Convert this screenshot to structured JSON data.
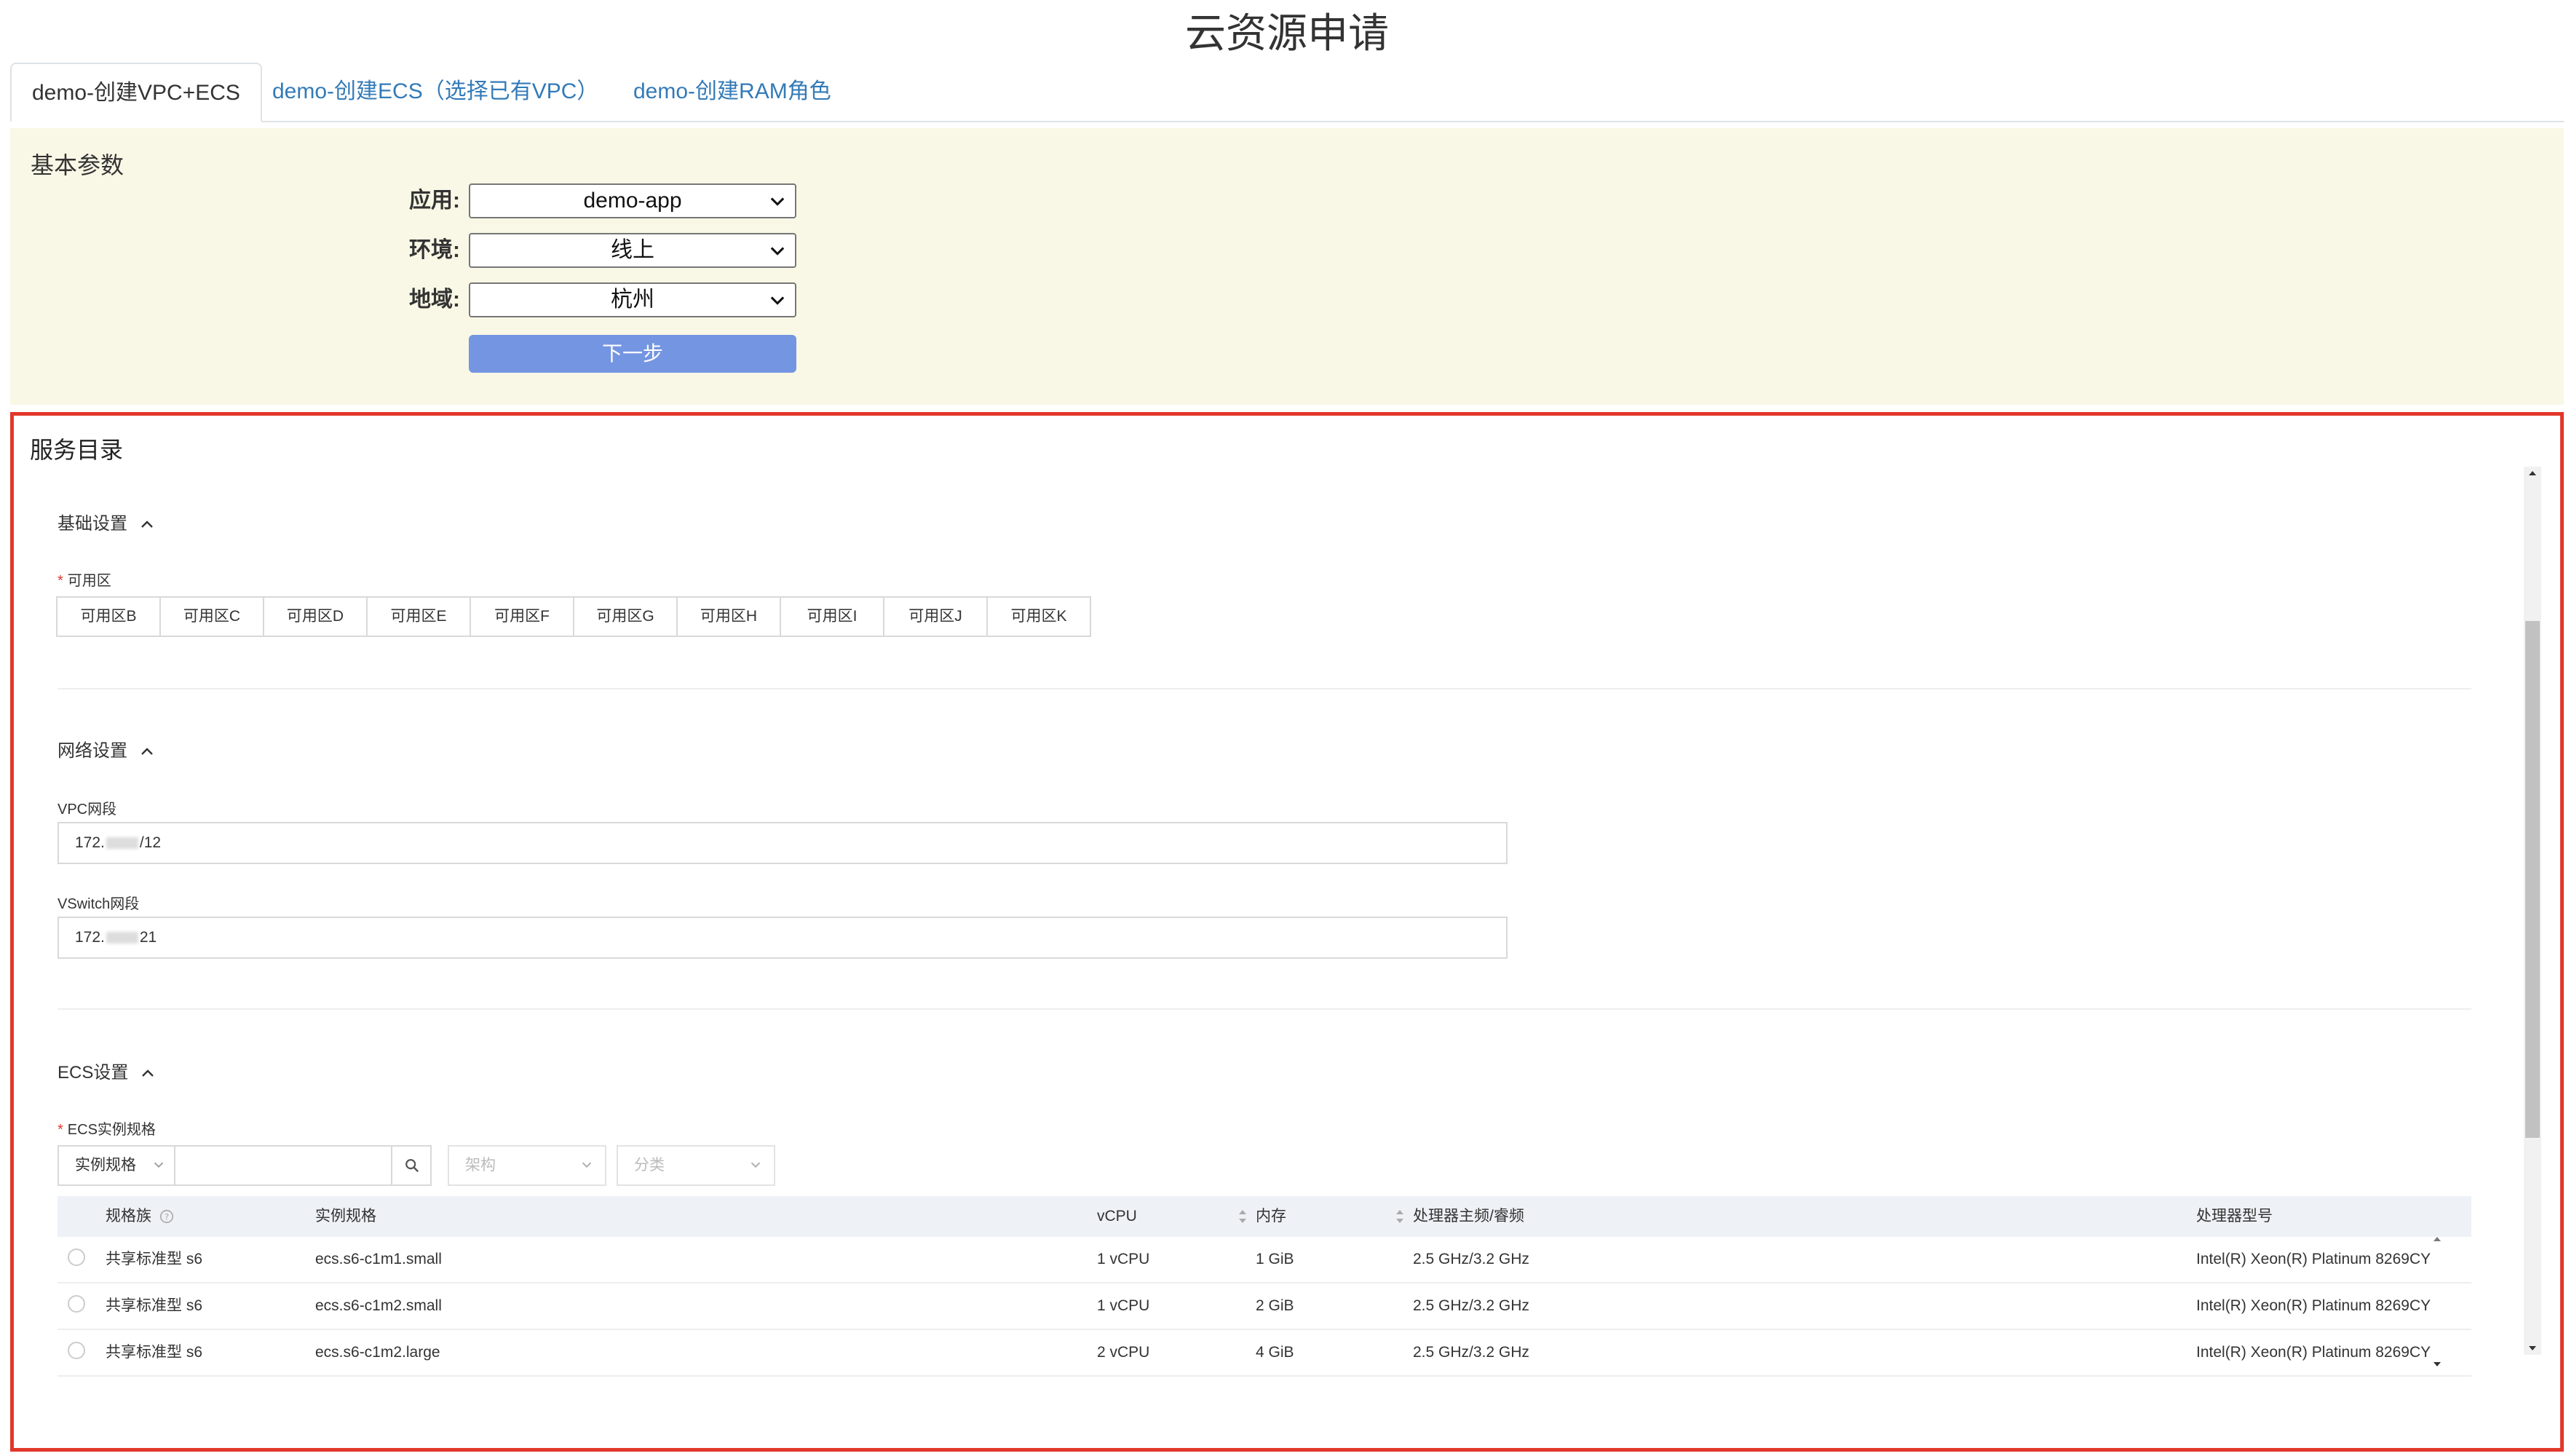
{
  "page": {
    "title": "云资源申请"
  },
  "tabs": [
    {
      "label": "demo-创建VPC+ECS",
      "active": true
    },
    {
      "label": "demo-创建ECS（选择已有VPC）",
      "active": false
    },
    {
      "label": "demo-创建RAM角色",
      "active": false
    }
  ],
  "basic": {
    "heading": "基本参数",
    "app_label": "应用:",
    "app_value": "demo-app",
    "env_label": "环境:",
    "env_value": "线上",
    "region_label": "地域:",
    "region_value": "杭州",
    "next_label": "下一步"
  },
  "catalog": {
    "heading": "服务目录",
    "base": {
      "title": "基础设置",
      "zone_label": "可用区",
      "zones": [
        "可用区B",
        "可用区C",
        "可用区D",
        "可用区E",
        "可用区F",
        "可用区G",
        "可用区H",
        "可用区I",
        "可用区J",
        "可用区K"
      ]
    },
    "network": {
      "title": "网络设置",
      "vpc_label": "VPC网段",
      "vpc_prefix": "172.",
      "vpc_suffix": "/12",
      "vswitch_label": "VSwitch网段",
      "vswitch_prefix": "172.",
      "vswitch_suffix": "21"
    },
    "ecs": {
      "title": "ECS设置",
      "spec_label": "ECS实例规格",
      "filter_type": "实例规格",
      "filter_input": "",
      "arch_placeholder": "架构",
      "category_placeholder": "分类",
      "columns": [
        "规格族",
        "实例规格",
        "vCPU",
        "内存",
        "处理器主频/睿频",
        "处理器型号"
      ],
      "rows": [
        {
          "family": "共享标准型 s6",
          "spec": "ecs.s6-c1m1.small",
          "vcpu": "1 vCPU",
          "mem": "1 GiB",
          "freq": "2.5 GHz/3.2 GHz",
          "cpu": "Intel(R) Xeon(R) Platinum 8269CY"
        },
        {
          "family": "共享标准型 s6",
          "spec": "ecs.s6-c1m2.small",
          "vcpu": "1 vCPU",
          "mem": "2 GiB",
          "freq": "2.5 GHz/3.2 GHz",
          "cpu": "Intel(R) Xeon(R) Platinum 8269CY"
        },
        {
          "family": "共享标准型 s6",
          "spec": "ecs.s6-c1m2.large",
          "vcpu": "2 vCPU",
          "mem": "4 GiB",
          "freq": "2.5 GHz/3.2 GHz",
          "cpu": "Intel(R) Xeon(R) Platinum 8269CY"
        }
      ]
    }
  },
  "colors": {
    "accent_border": "#e2372b",
    "primary_button": "#7495e1",
    "panel_bg": "#f9f8e6",
    "link": "#337ab7"
  }
}
